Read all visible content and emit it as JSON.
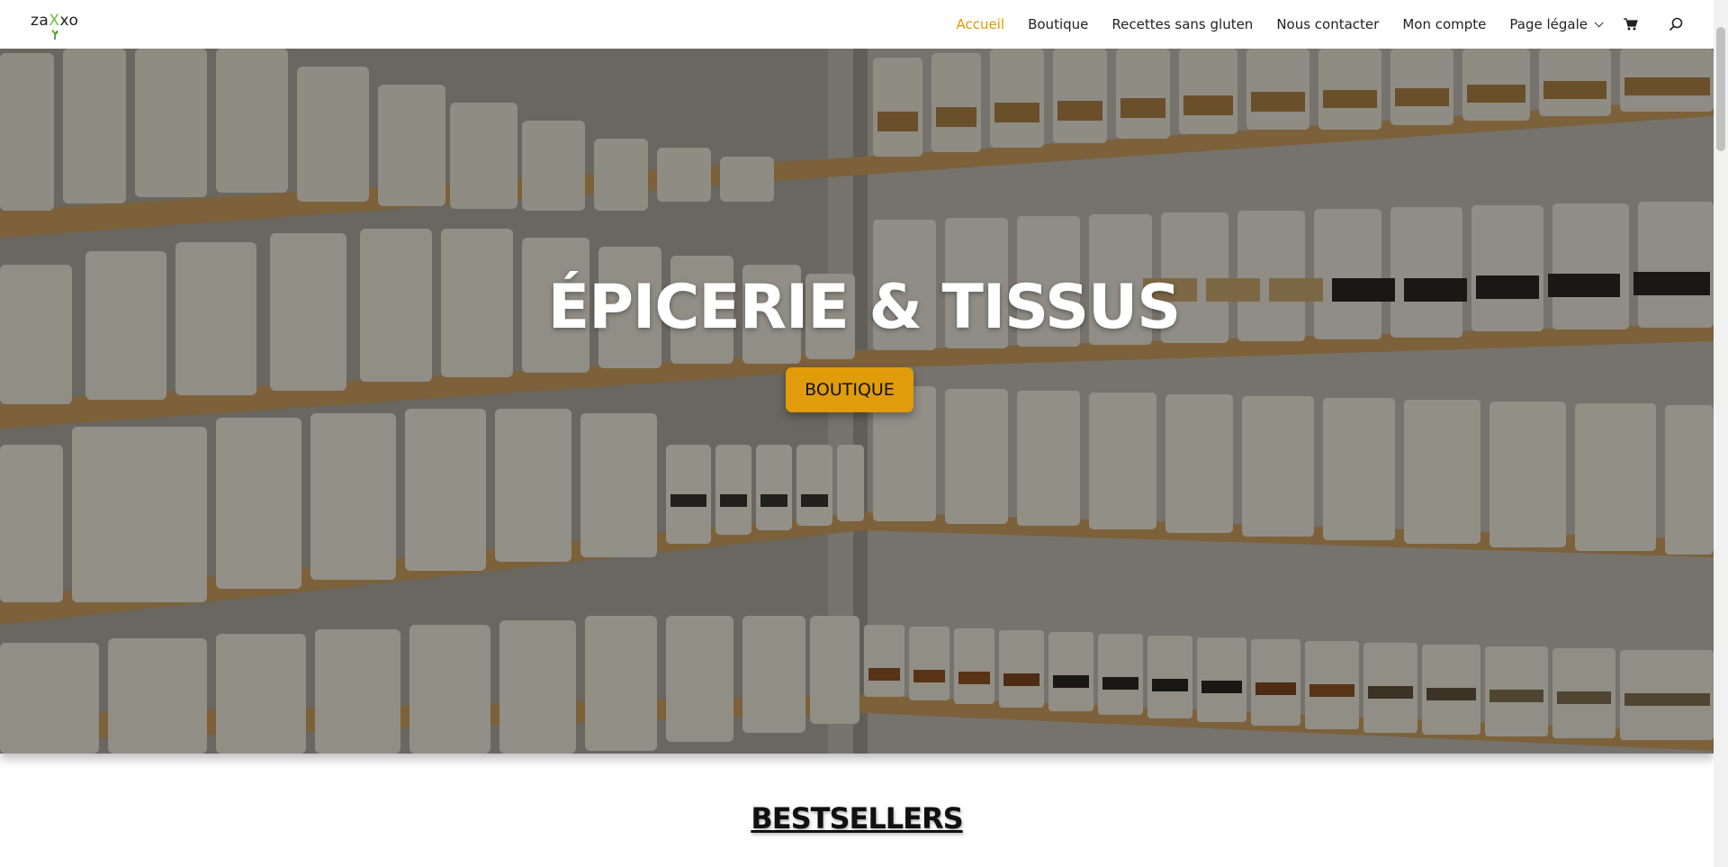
{
  "header": {
    "logo_text_left": "za",
    "logo_text_x": "X",
    "logo_text_right": "xo",
    "nav": [
      {
        "label": "Accueil",
        "active": true
      },
      {
        "label": "Boutique"
      },
      {
        "label": "Recettes sans gluten"
      },
      {
        "label": "Nous contacter"
      },
      {
        "label": "Mon compte"
      },
      {
        "label": "Page légale",
        "dropdown": true
      }
    ],
    "icons": [
      "cart-icon",
      "search-icon"
    ]
  },
  "hero": {
    "title": "ÉPICERIE & TISSUS",
    "button_label": "BOUTIQUE"
  },
  "section": {
    "title": "BESTSELLERS"
  },
  "colors": {
    "accent": "#e09900",
    "button": "#e09c0a",
    "logo_green": "#6bbf3a"
  }
}
